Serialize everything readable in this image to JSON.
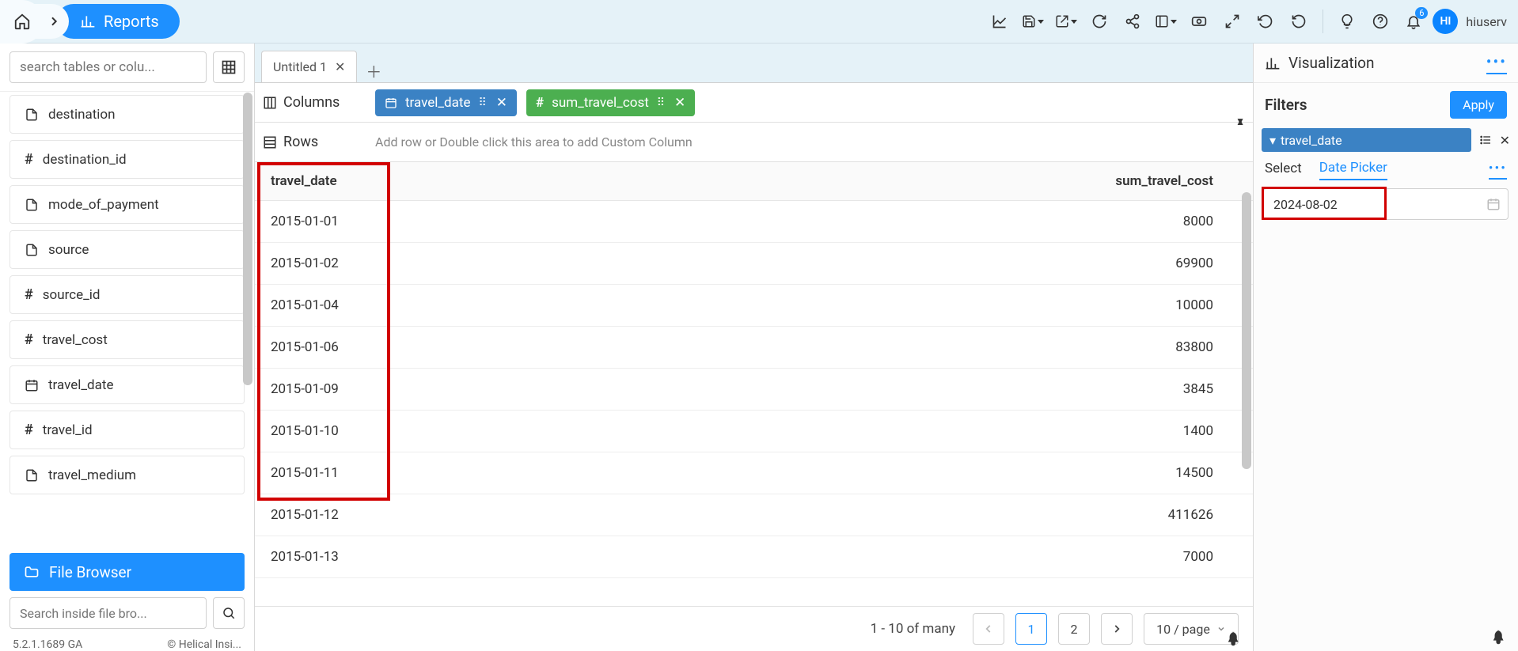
{
  "nav": {
    "reports_label": "Reports"
  },
  "user": {
    "initials": "HI",
    "name": "hiuserv",
    "notif_count": "6"
  },
  "left": {
    "search_placeholder": "search tables or colu...",
    "fields": [
      {
        "icon": "doc",
        "label": "destination"
      },
      {
        "icon": "hash",
        "label": "destination_id"
      },
      {
        "icon": "doc",
        "label": "mode_of_payment"
      },
      {
        "icon": "doc",
        "label": "source"
      },
      {
        "icon": "hash",
        "label": "source_id"
      },
      {
        "icon": "hash",
        "label": "travel_cost"
      },
      {
        "icon": "cal",
        "label": "travel_date"
      },
      {
        "icon": "hash",
        "label": "travel_id"
      },
      {
        "icon": "doc",
        "label": "travel_medium"
      }
    ],
    "file_browser_label": "File Browser",
    "file_search_placeholder": "Search inside file bro...",
    "version": "5.2.1.1689 GA",
    "copyright": "© Helical Insi..."
  },
  "center": {
    "tab_name": "Untitled 1",
    "columns_label": "Columns",
    "rows_label": "Rows",
    "rows_hint": "Add row or Double click this area to add Custom Column",
    "col_pill_1": "travel_date",
    "col_pill_2": "sum_travel_cost",
    "table": {
      "headers": {
        "c1": "travel_date",
        "c2": "sum_travel_cost"
      },
      "rows": [
        {
          "d": "2015-01-01",
          "v": "8000"
        },
        {
          "d": "2015-01-02",
          "v": "69900"
        },
        {
          "d": "2015-01-04",
          "v": "10000"
        },
        {
          "d": "2015-01-06",
          "v": "83800"
        },
        {
          "d": "2015-01-09",
          "v": "3845"
        },
        {
          "d": "2015-01-10",
          "v": "1400"
        },
        {
          "d": "2015-01-11",
          "v": "14500"
        },
        {
          "d": "2015-01-12",
          "v": "411626"
        },
        {
          "d": "2015-01-13",
          "v": "7000"
        }
      ]
    },
    "pager": {
      "info": "1 - 10 of many",
      "p1": "1",
      "p2": "2",
      "per_page": "10 / page"
    }
  },
  "right": {
    "viz_label": "Visualization",
    "filters_label": "Filters",
    "apply_label": "Apply",
    "filter_field": "travel_date",
    "tab_select": "Select",
    "tab_datepicker": "Date Picker",
    "date_value": "2024-08-02"
  }
}
